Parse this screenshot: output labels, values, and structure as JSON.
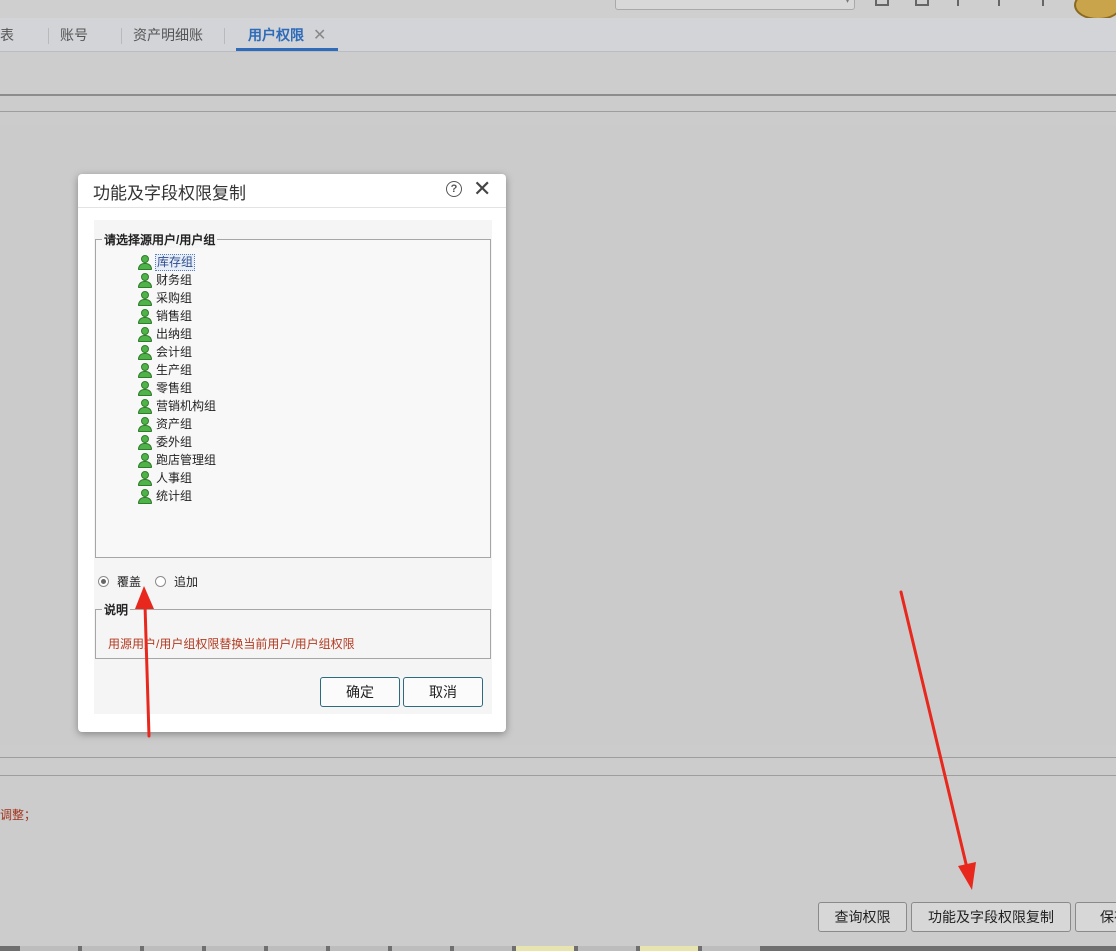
{
  "tabs": [
    {
      "label": "表"
    },
    {
      "label": "账号"
    },
    {
      "label": "资产明细账"
    },
    {
      "label": "用户权限"
    }
  ],
  "tab_close_icon": "close-icon",
  "lower_note": "调整；",
  "bottom_buttons": {
    "query": "查询权限",
    "copy": "功能及字段权限复制",
    "save": "保存"
  },
  "dialog": {
    "title": "功能及字段权限复制",
    "help_symbol": "?",
    "close_symbol": "✕",
    "source_legend": "请选择源用户/用户组",
    "groups": [
      "库存组",
      "财务组",
      "采购组",
      "销售组",
      "出纳组",
      "会计组",
      "生产组",
      "零售组",
      "营销机构组",
      "资产组",
      "委外组",
      "跑店管理组",
      "人事组",
      "统计组"
    ],
    "selected_group_index": 0,
    "radio": {
      "overwrite": "覆盖",
      "append": "追加",
      "selected": "overwrite"
    },
    "desc_legend": "说明",
    "desc_text": "用源用户/用户组权限替换当前用户/用户组权限",
    "ok": "确定",
    "cancel": "取消"
  },
  "colors": {
    "accent": "#2e6bb8",
    "annotation_arrow": "#e8281c",
    "note_text": "#b23b22",
    "user_icon": "#4fb34a"
  }
}
